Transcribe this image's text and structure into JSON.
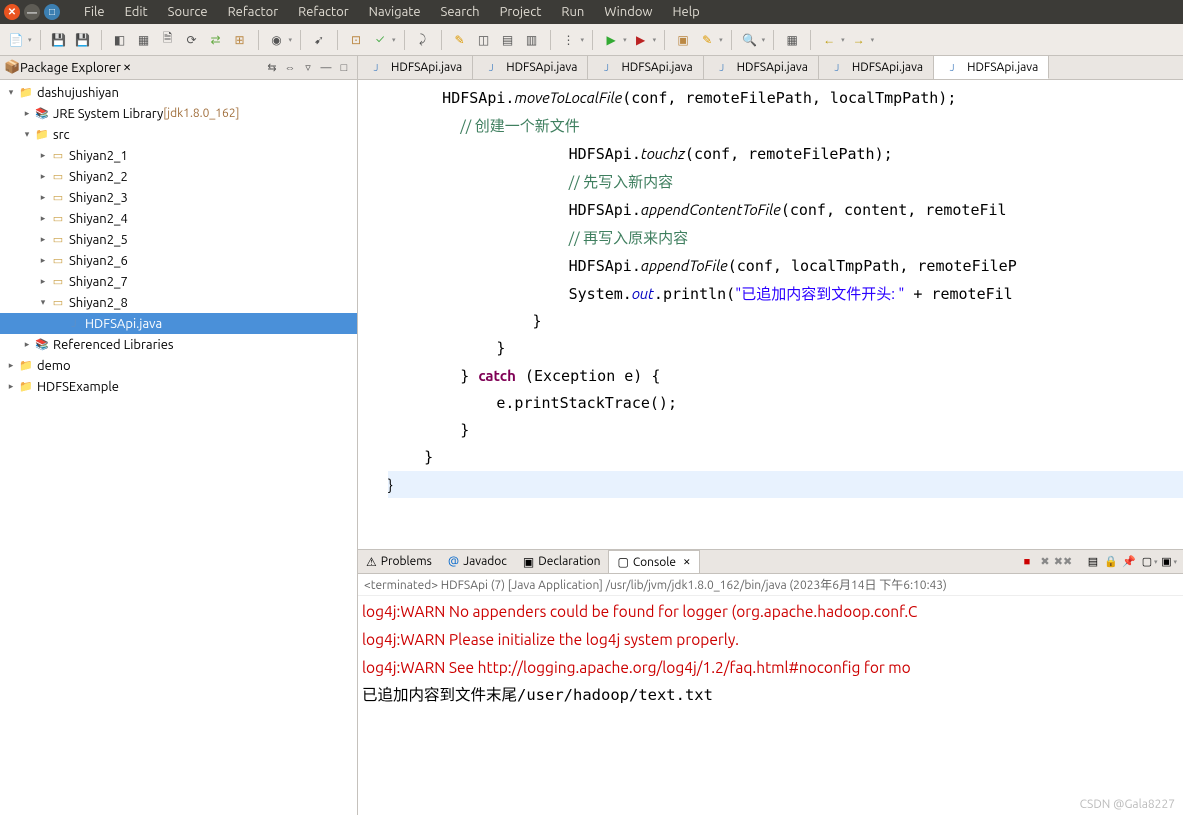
{
  "menubar": [
    "File",
    "Edit",
    "Source",
    "Refactor",
    "Refactor",
    "Navigate",
    "Search",
    "Project",
    "Run",
    "Window",
    "Help"
  ],
  "package_explorer": {
    "title": "Package Explorer",
    "root": "dashujushiyan",
    "jre": "JRE System Library",
    "jre_tag": "[jdk1.8.0_162]",
    "src": "src",
    "packages": [
      "Shiyan2_1",
      "Shiyan2_2",
      "Shiyan2_3",
      "Shiyan2_4",
      "Shiyan2_5",
      "Shiyan2_6",
      "Shiyan2_7",
      "Shiyan2_8"
    ],
    "selected_file": "HDFSApi.java",
    "ref_libs": "Referenced Libraries",
    "other_projects": [
      "demo",
      "HDFSExample"
    ]
  },
  "editor_tabs": [
    "HDFSApi.java",
    "HDFSApi.java",
    "HDFSApi.java",
    "HDFSApi.java",
    "HDFSApi.java",
    "HDFSApi.java"
  ],
  "code": {
    "l1a": "HDFSApi.",
    "l1b": "moveToLocalFile",
    "l1c": "(conf, remoteFilePath, localTmpPath);",
    "l2": "// 创建一个新文件",
    "l3a": "HDFSApi.",
    "l3b": "touchz",
    "l3c": "(conf, remoteFilePath);",
    "l4": "// 先写入新内容",
    "l5a": "HDFSApi.",
    "l5b": "appendContentToFile",
    "l5c": "(conf, content, remoteFil",
    "l6": "// 再写入原来内容",
    "l7a": "HDFSApi.",
    "l7b": "appendToFile",
    "l7c": "(conf, localTmpPath, remoteFileP",
    "l8a": "System.",
    "l8b": "out",
    "l8c": ".println(",
    "l8d": "\"已追加内容到文件开头: \"",
    "l8e": " + remoteFil",
    "l9": "}",
    "l10": "}",
    "l11a": "} ",
    "l11b": "catch",
    "l11c": " (Exception e) {",
    "l12": "e.printStackTrace();",
    "l13": "}",
    "l14": "}",
    "l15": "}"
  },
  "bottom_tabs": {
    "problems": "Problems",
    "javadoc": "Javadoc",
    "declaration": "Declaration",
    "console": "Console"
  },
  "console": {
    "header": "<terminated> HDFSApi (7) [Java Application] /usr/lib/jvm/jdk1.8.0_162/bin/java (2023年6月14日 下午6:10:43)",
    "l1": "log4j:WARN No appenders could be found for logger (org.apache.hadoop.conf.C",
    "l2": "log4j:WARN Please initialize the log4j system properly.",
    "l3": "log4j:WARN See http://logging.apache.org/log4j/1.2/faq.html#noconfig for mo",
    "l4": "已追加内容到文件末尾/user/hadoop/text.txt"
  },
  "watermark": "CSDN @Gala8227"
}
